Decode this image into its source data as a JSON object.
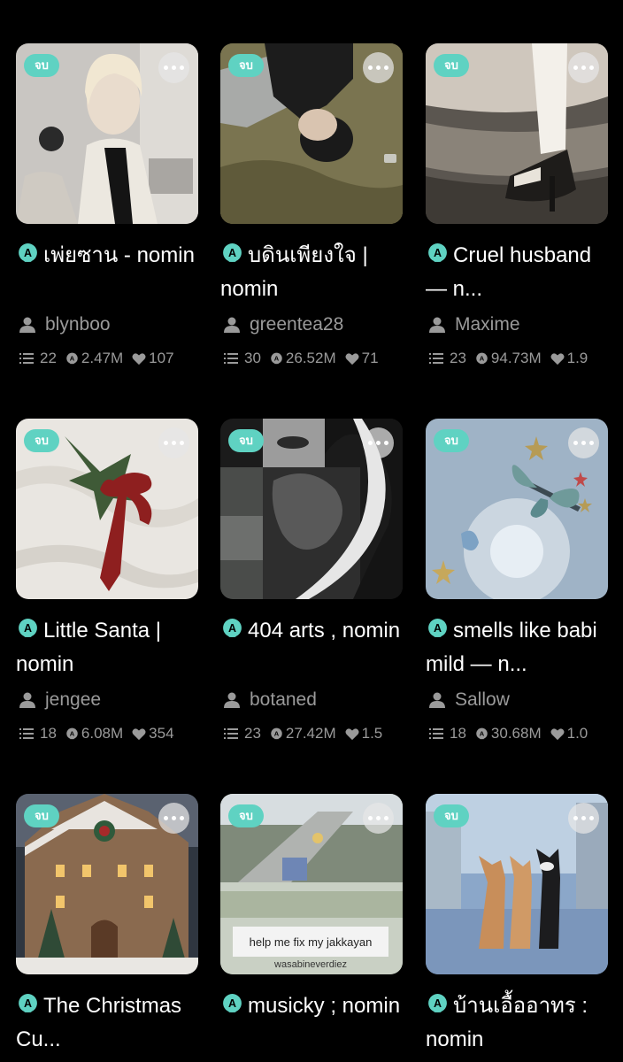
{
  "status_badge_label": "จบ",
  "cards": [
    {
      "title": "เพ่ยซาน - nomin",
      "author": "blynboo",
      "parts": "22",
      "reads": "2.47M",
      "votes": "107"
    },
    {
      "title": "บดินเพียงใจ | nomin",
      "author": "greentea28",
      "parts": "30",
      "reads": "26.52M",
      "votes": "71"
    },
    {
      "title": "Cruel husband — n...",
      "author": "Maxime",
      "parts": "23",
      "reads": "94.73M",
      "votes": "1.9"
    },
    {
      "title": "Little Santa | nomin",
      "author": "jengee",
      "parts": "18",
      "reads": "6.08M",
      "votes": "354"
    },
    {
      "title": "404 arts , nomin",
      "author": "botaned",
      "parts": "23",
      "reads": "27.42M",
      "votes": "1.5"
    },
    {
      "title": "smells like babi mild — n...",
      "author": "Sallow",
      "parts": "18",
      "reads": "30.68M",
      "votes": "1.0"
    },
    {
      "title": "The Christmas Cu...",
      "author": "",
      "parts": "",
      "reads": "",
      "votes": ""
    },
    {
      "title": "musicky ; nomin",
      "author": "",
      "parts": "",
      "reads": "",
      "votes": ""
    },
    {
      "title": "บ้านเอื้ออาทร : nomin",
      "author": "",
      "parts": "",
      "reads": "",
      "votes": ""
    }
  ],
  "cover_texts": {
    "card_8_caption": "help me fix my jakkayan",
    "card_8_watermark": "wasabineverdiez"
  },
  "colors": {
    "background": "#000000",
    "badge": "#5fd2c2",
    "accent_icon": "#5fd2c2",
    "muted_text": "#9a9a9a"
  },
  "icons": {
    "story": "story-icon",
    "more": "more-dots-icon",
    "author": "user-icon",
    "parts": "list-icon",
    "reads": "reads-icon",
    "votes": "heart-icon"
  }
}
